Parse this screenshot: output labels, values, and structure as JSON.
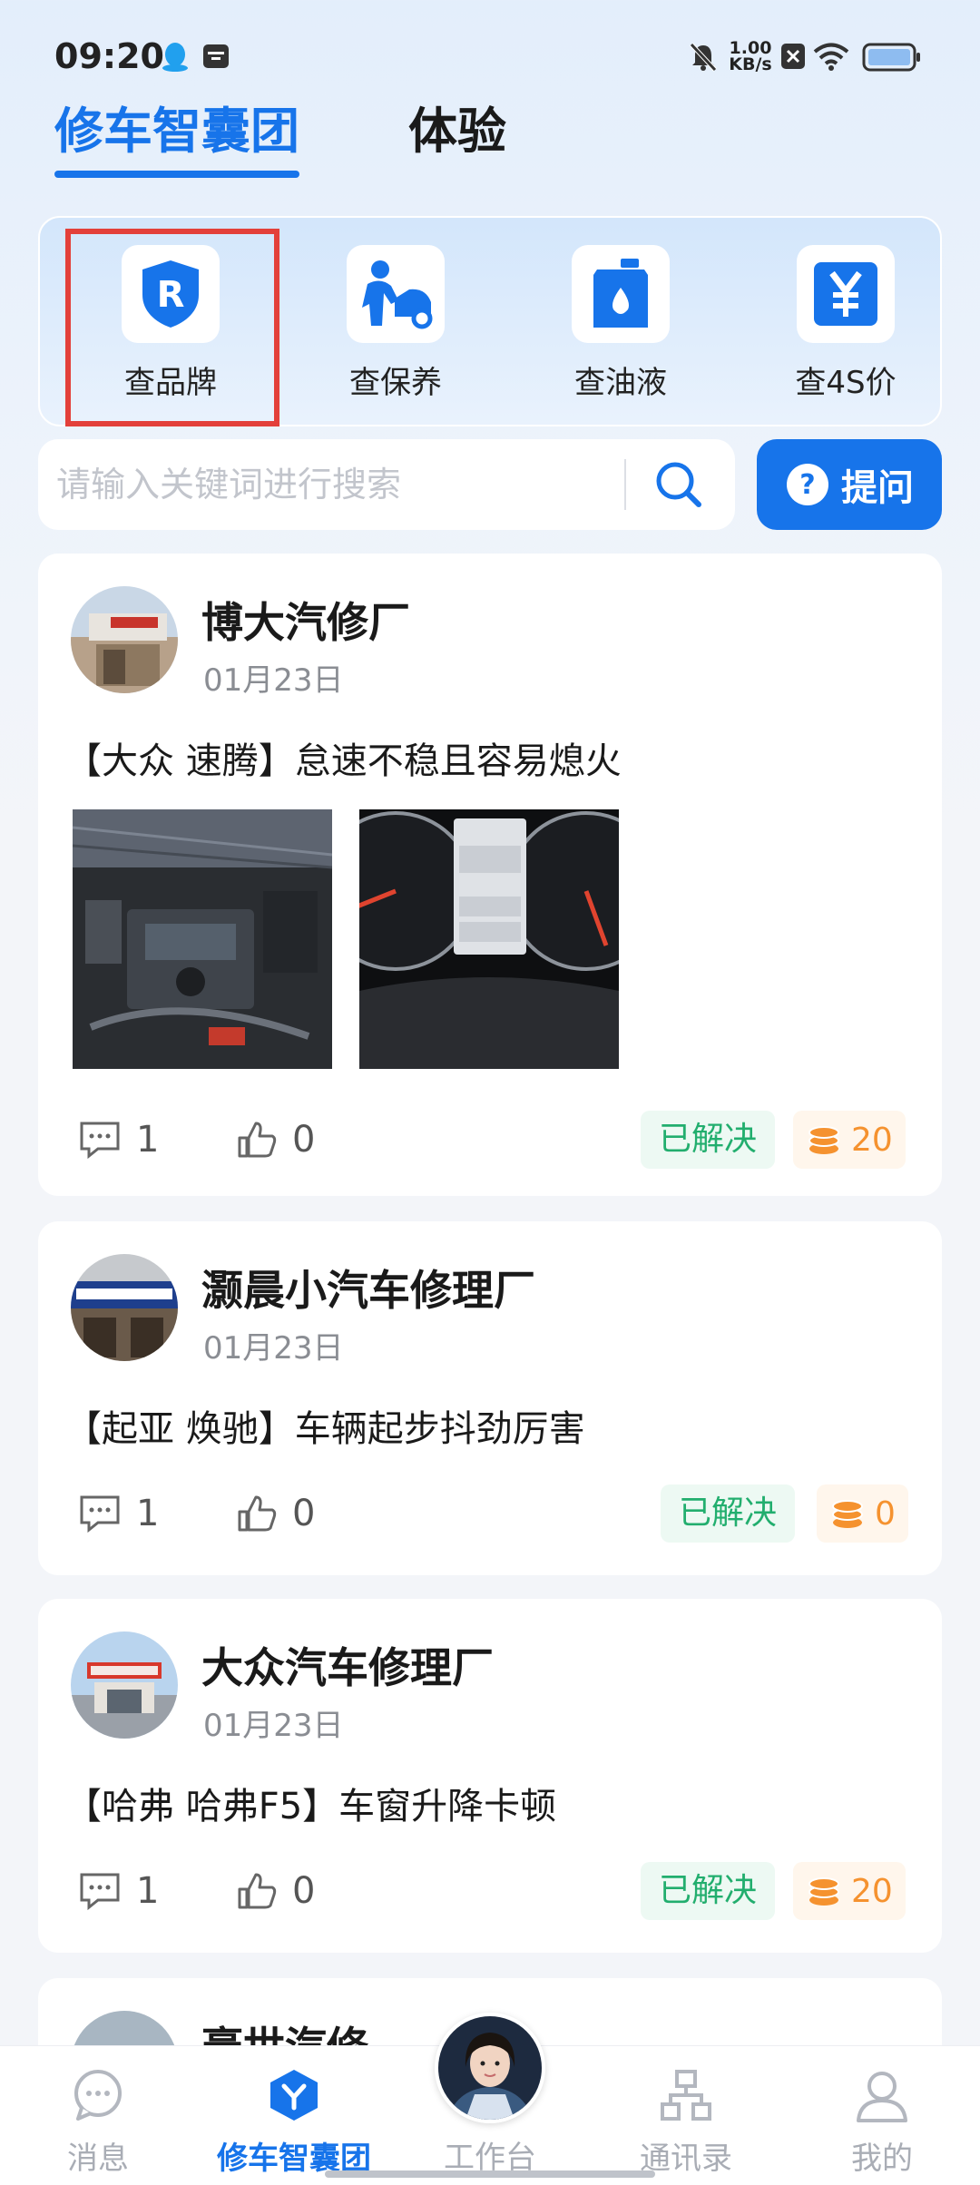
{
  "status_bar": {
    "time": "09:20",
    "net_speed_value": "1.00",
    "net_speed_unit": "KB/s"
  },
  "top_tabs": [
    {
      "label": "修车智囊团",
      "active": true
    },
    {
      "label": "体验",
      "active": false
    }
  ],
  "quick_tools": [
    {
      "label": "查品牌",
      "icon": "brand-shield-icon",
      "highlighted": true
    },
    {
      "label": "查保养",
      "icon": "maintenance-icon",
      "highlighted": false
    },
    {
      "label": "查油液",
      "icon": "oil-can-icon",
      "highlighted": false
    },
    {
      "label": "查4S价",
      "icon": "yen-price-icon",
      "highlighted": false
    }
  ],
  "search": {
    "placeholder": "请输入关键词进行搜索",
    "ask_label": "提问"
  },
  "posts": [
    {
      "shop": "博大汽修厂",
      "date": "01月23日",
      "title": "【大众 速腾】怠速不稳且容易熄火",
      "images": [
        "engine-bay-photo",
        "dashboard-photo"
      ],
      "comments": "1",
      "likes": "0",
      "status": "已解决",
      "coins": "20"
    },
    {
      "shop": "灏晨小汽车修理厂",
      "date": "01月23日",
      "title": "【起亚 焕驰】车辆起步抖劲厉害",
      "comments": "1",
      "likes": "0",
      "status": "已解决",
      "coins": "0"
    },
    {
      "shop": "大众汽车修理厂",
      "date": "01月23日",
      "title": "【哈弗 哈弗F5】车窗升降卡顿",
      "comments": "1",
      "likes": "0",
      "status": "已解决",
      "coins": "20"
    },
    {
      "shop": "豪世汽修"
    }
  ],
  "bottom_nav": [
    {
      "label": "消息",
      "icon": "message-icon",
      "active": false
    },
    {
      "label": "修车智囊团",
      "icon": "think-tank-icon",
      "active": true
    },
    {
      "label": "工作台",
      "icon": "assistant-avatar",
      "active": false
    },
    {
      "label": "通讯录",
      "icon": "org-chart-icon",
      "active": false
    },
    {
      "label": "我的",
      "icon": "user-icon",
      "active": false
    }
  ],
  "colors": {
    "accent": "#1774ea",
    "solved": "#22ae6e",
    "coin": "#f5922f",
    "highlight": "#e3403a"
  }
}
